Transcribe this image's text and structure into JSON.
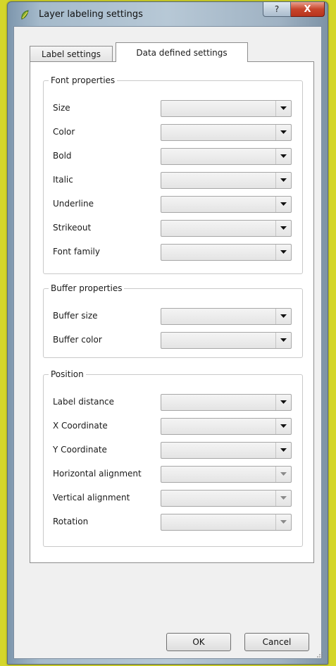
{
  "window": {
    "title": "Layer labeling settings",
    "help_glyph": "?",
    "close_glyph": "X"
  },
  "tabs": [
    {
      "label": "Label settings",
      "active": false
    },
    {
      "label": "Data defined settings",
      "active": true
    }
  ],
  "groups": {
    "font": {
      "title": "Font properties",
      "rows": [
        {
          "label": "Size",
          "value": "",
          "enabled": true
        },
        {
          "label": "Color",
          "value": "",
          "enabled": true
        },
        {
          "label": "Bold",
          "value": "",
          "enabled": true
        },
        {
          "label": "Italic",
          "value": "",
          "enabled": true
        },
        {
          "label": "Underline",
          "value": "",
          "enabled": true
        },
        {
          "label": "Strikeout",
          "value": "",
          "enabled": true
        },
        {
          "label": "Font family",
          "value": "",
          "enabled": true
        }
      ]
    },
    "buffer": {
      "title": "Buffer properties",
      "rows": [
        {
          "label": "Buffer size",
          "value": "",
          "enabled": true
        },
        {
          "label": "Buffer color",
          "value": "",
          "enabled": true
        }
      ]
    },
    "position": {
      "title": "Position",
      "rows": [
        {
          "label": "Label distance",
          "value": "",
          "enabled": true
        },
        {
          "label": "X Coordinate",
          "value": "",
          "enabled": true
        },
        {
          "label": "Y Coordinate",
          "value": "",
          "enabled": true
        },
        {
          "label": "Horizontal alignment",
          "value": "",
          "enabled": false
        },
        {
          "label": "Vertical alignment",
          "value": "",
          "enabled": false
        },
        {
          "label": "Rotation",
          "value": "",
          "enabled": false
        }
      ]
    }
  },
  "buttons": {
    "ok": "OK",
    "cancel": "Cancel"
  },
  "colors": {
    "desktop": "#d4d62a",
    "close_button": "#c7452c"
  },
  "icons": {
    "app": "qgis-icon",
    "help": "help-icon",
    "close": "close-icon",
    "dropdown": "chevron-down-icon"
  }
}
